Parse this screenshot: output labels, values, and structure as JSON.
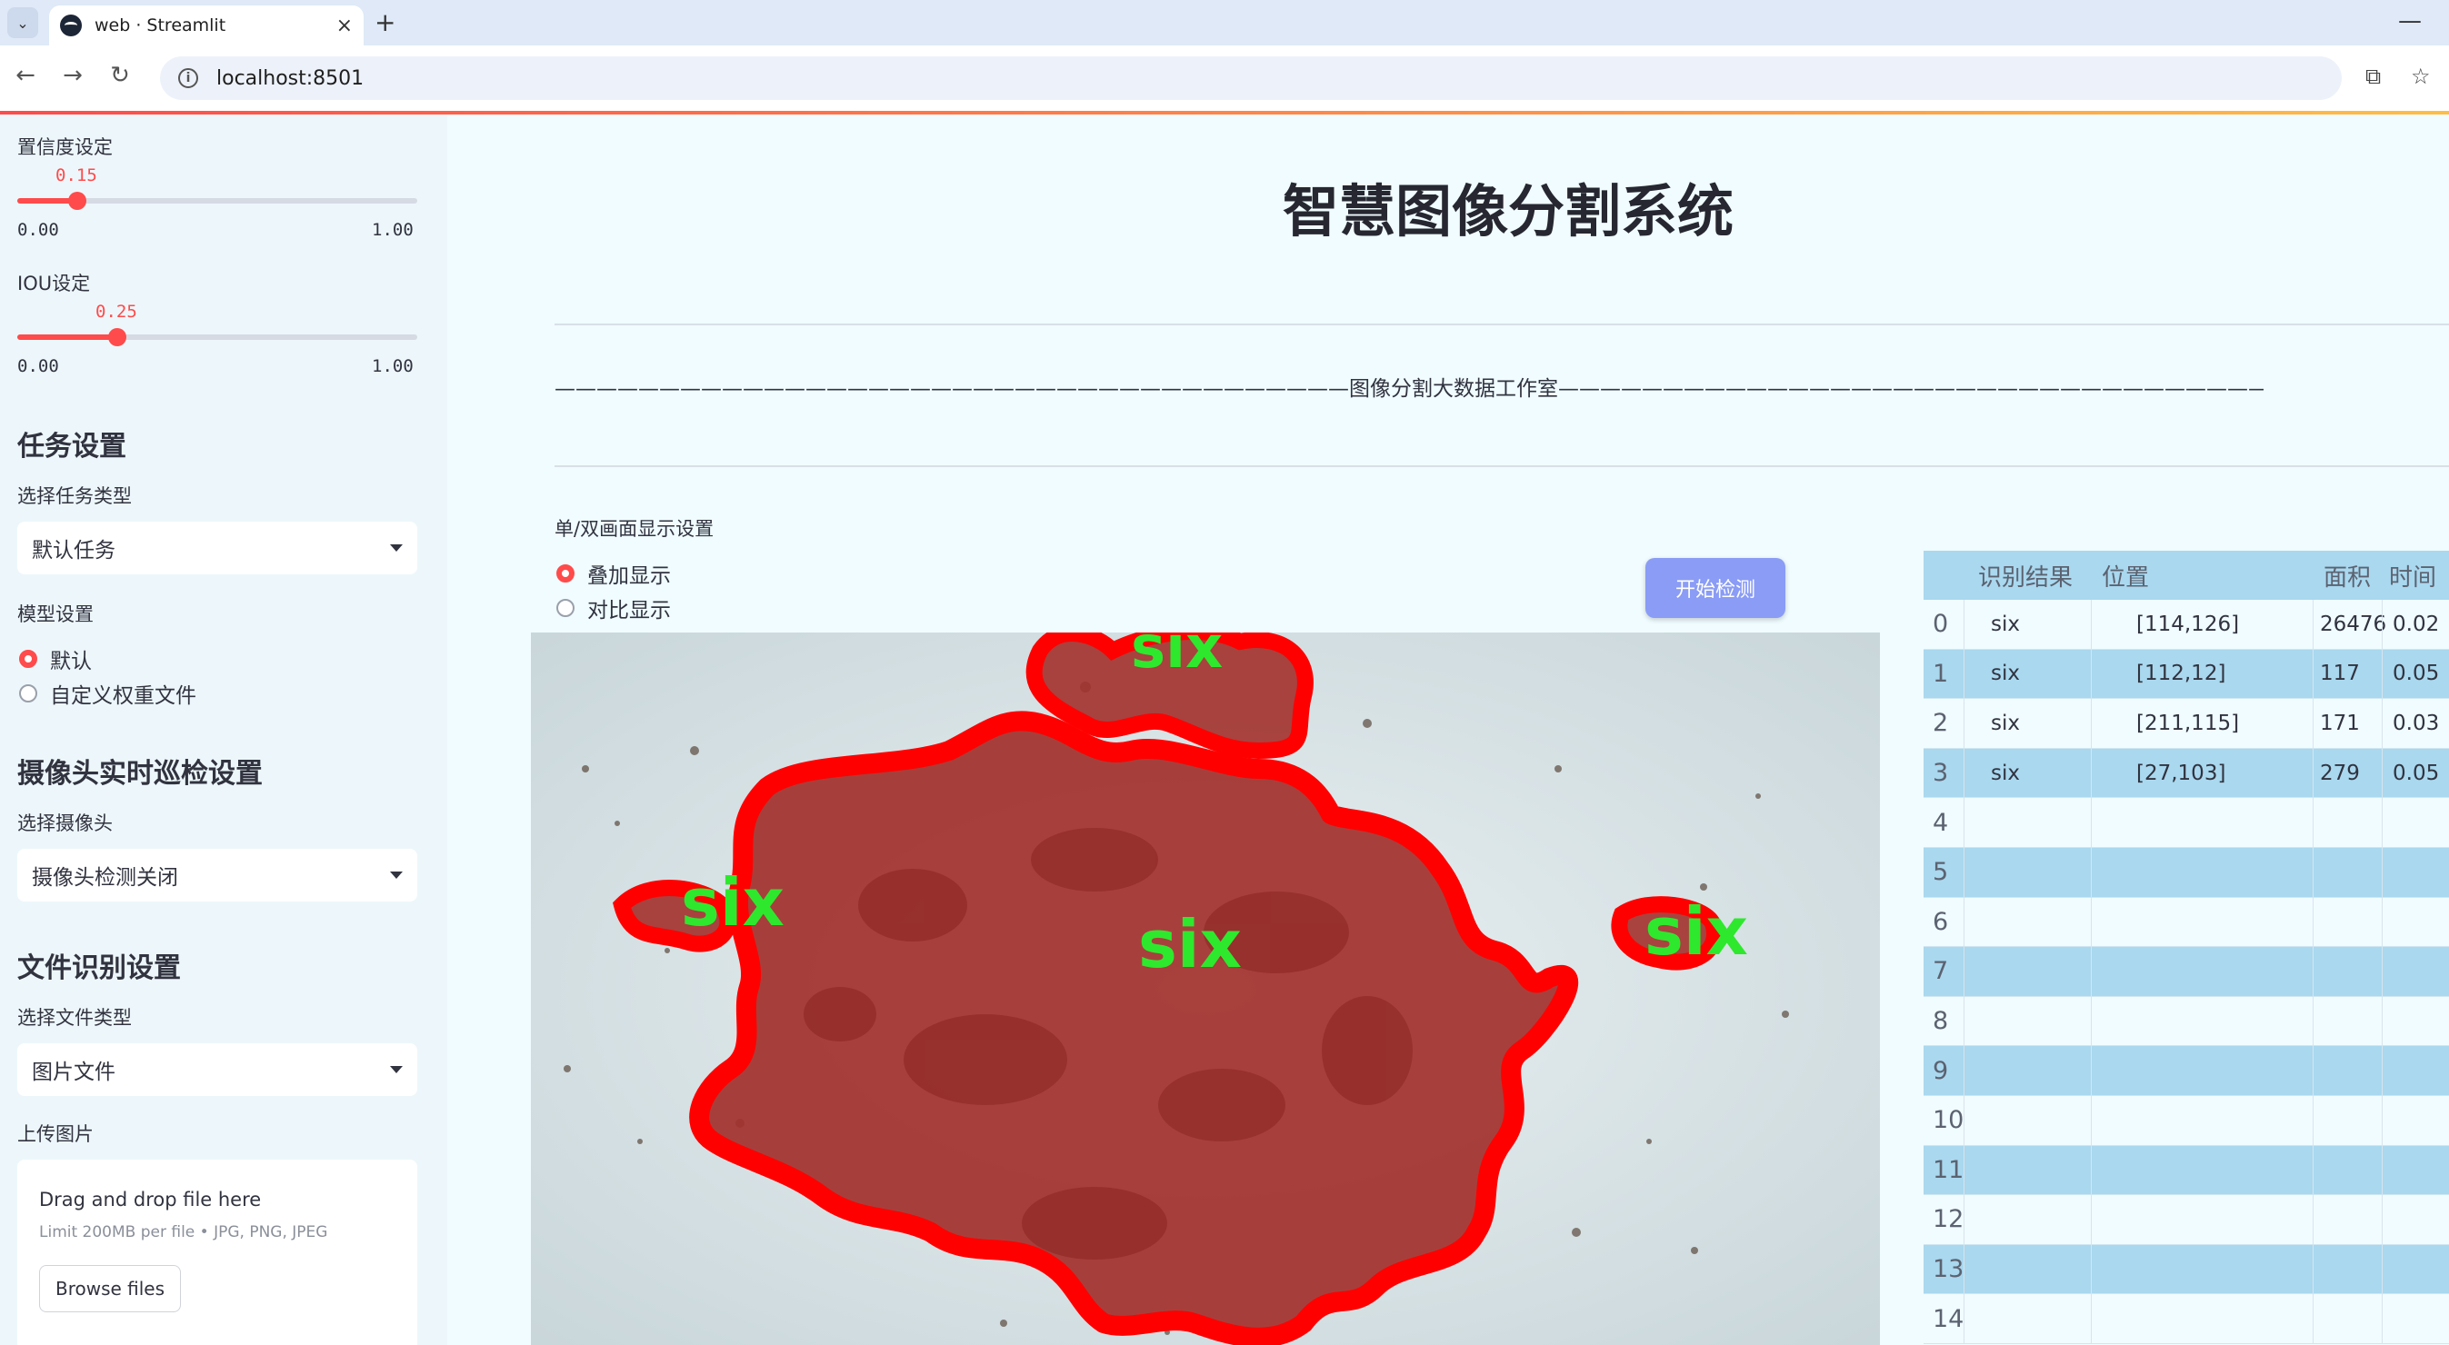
{
  "browser": {
    "tab_title": "web · Streamlit",
    "url": "localhost:8501",
    "new_tab": "+",
    "close": "×",
    "minimize": "—"
  },
  "sidebar": {
    "confidence": {
      "label": "置信度设定",
      "value": "0.15",
      "fraction": 0.15,
      "min": "0.00",
      "max": "1.00"
    },
    "iou": {
      "label": "IOU设定",
      "value": "0.25",
      "fraction": 0.25,
      "min": "0.00",
      "max": "1.00"
    },
    "task_header": "任务设置",
    "task_type_label": "选择任务类型",
    "task_type_value": "默认任务",
    "model_label": "模型设置",
    "model_options": [
      "默认",
      "自定义权重文件"
    ],
    "camera_header": "摄像头实时巡检设置",
    "camera_label": "选择摄像头",
    "camera_value": "摄像头检测关闭",
    "file_header": "文件识别设置",
    "file_type_label": "选择文件类型",
    "file_type_value": "图片文件",
    "upload_label": "上传图片",
    "upload_title": "Drag and drop file here",
    "upload_limit": "Limit 200MB per file • JPG, PNG, JPEG",
    "browse_label": "Browse files"
  },
  "main": {
    "title": "智慧图像分割系统",
    "studio": "——————————————————————————————————————图像分割大数据工作室——————————————————————————————————————",
    "mode_label": "单/双画面显示设置",
    "mode_options": [
      "叠加显示",
      "对比显示"
    ],
    "start_button": "开始检测",
    "image_labels": [
      "six",
      "six",
      "six",
      "six"
    ]
  },
  "table": {
    "headers": [
      "识别结果",
      "位置",
      "面积",
      "时间"
    ],
    "rows": [
      {
        "idx": "0",
        "result": "six",
        "pos": "[114,126]",
        "area": "26476",
        "time": "0.02"
      },
      {
        "idx": "1",
        "result": "six",
        "pos": "[112,12]",
        "area": "117",
        "time": "0.05"
      },
      {
        "idx": "2",
        "result": "six",
        "pos": "[211,115]",
        "area": "171",
        "time": "0.03"
      },
      {
        "idx": "3",
        "result": "six",
        "pos": "[27,103]",
        "area": "279",
        "time": "0.05"
      },
      {
        "idx": "4",
        "result": "",
        "pos": "",
        "area": "",
        "time": ""
      },
      {
        "idx": "5",
        "result": "",
        "pos": "",
        "area": "",
        "time": ""
      },
      {
        "idx": "6",
        "result": "",
        "pos": "",
        "area": "",
        "time": ""
      },
      {
        "idx": "7",
        "result": "",
        "pos": "",
        "area": "",
        "time": ""
      },
      {
        "idx": "8",
        "result": "",
        "pos": "",
        "area": "",
        "time": ""
      },
      {
        "idx": "9",
        "result": "",
        "pos": "",
        "area": "",
        "time": ""
      },
      {
        "idx": "10",
        "result": "",
        "pos": "",
        "area": "",
        "time": ""
      },
      {
        "idx": "11",
        "result": "",
        "pos": "",
        "area": "",
        "time": ""
      },
      {
        "idx": "12",
        "result": "",
        "pos": "",
        "area": "",
        "time": ""
      },
      {
        "idx": "13",
        "result": "",
        "pos": "",
        "area": "",
        "time": ""
      },
      {
        "idx": "14",
        "result": "",
        "pos": "",
        "area": "",
        "time": ""
      }
    ]
  },
  "colors": {
    "accent": "#ff4b4b",
    "button": "#8a9cf5",
    "table_stripe": "#a9d8ef",
    "label_green": "#2ee82e"
  }
}
